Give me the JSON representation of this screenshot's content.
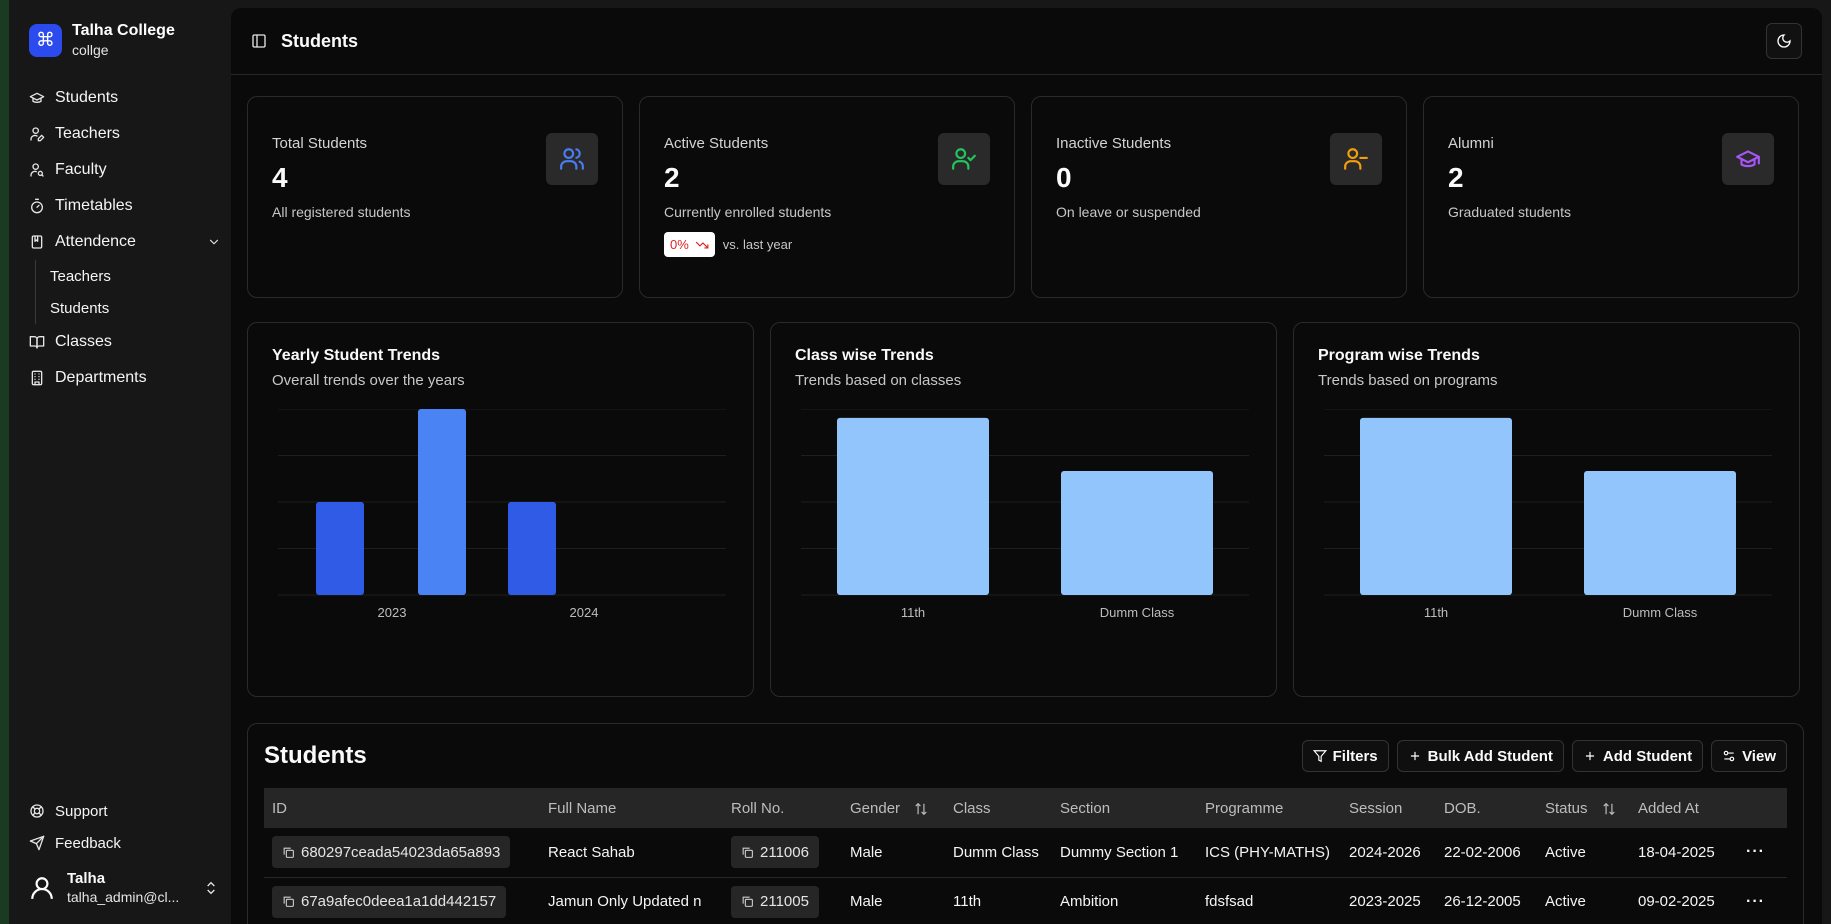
{
  "brand": {
    "name": "Talha College",
    "sub": "collge"
  },
  "nav": {
    "items": [
      {
        "label": "Students",
        "icon": "graduation-cap-icon"
      },
      {
        "label": "Teachers",
        "icon": "user-pen-icon"
      },
      {
        "label": "Faculty",
        "icon": "user-search-icon"
      },
      {
        "label": "Timetables",
        "icon": "timer-icon"
      },
      {
        "label": "Attendence",
        "icon": "notebook-icon"
      }
    ],
    "attendence_sub": [
      {
        "label": "Teachers"
      },
      {
        "label": "Students"
      }
    ],
    "items2": [
      {
        "label": "Classes",
        "icon": "book-open-icon"
      },
      {
        "label": "Departments",
        "icon": "building-icon"
      }
    ],
    "bottom": [
      {
        "label": "Support",
        "icon": "life-buoy-icon"
      },
      {
        "label": "Feedback",
        "icon": "send-icon"
      }
    ]
  },
  "user": {
    "name": "Talha",
    "email": "talha_admin@cl..."
  },
  "header": {
    "title": "Students"
  },
  "stats": [
    {
      "label": "Total Students",
      "value": "4",
      "desc": "All registered students",
      "icon": "users-icon",
      "color": "#4a7cf3"
    },
    {
      "label": "Active Students",
      "value": "2",
      "desc": "Currently enrolled students",
      "icon": "user-check-icon",
      "color": "#22c55e",
      "trend": {
        "badge": "0%",
        "text": "vs. last year"
      }
    },
    {
      "label": "Inactive Students",
      "value": "0",
      "desc": "On leave or suspended",
      "icon": "user-minus-icon",
      "color": "#f59e0b"
    },
    {
      "label": "Alumni",
      "value": "2",
      "desc": "Graduated students",
      "icon": "graduation-cap-icon",
      "color": "#a855f7"
    }
  ],
  "charts": [
    {
      "title": "Yearly Student Trends",
      "subtitle": "Overall trends over the years"
    },
    {
      "title": "Class wise Trends",
      "subtitle": "Trends based on classes"
    },
    {
      "title": "Program wise Trends",
      "subtitle": "Trends based on programs"
    }
  ],
  "chart_data": [
    {
      "type": "bar",
      "title": "Yearly Student Trends",
      "tick_labels": [
        "2023",
        "2024"
      ],
      "values": [
        1,
        2,
        1
      ],
      "ylim": [
        0,
        2
      ],
      "colors": [
        "#2f5be6",
        "#4a84f4",
        "#2f5be6"
      ],
      "grid": true
    },
    {
      "type": "bar",
      "title": "Class wise Trends",
      "categories": [
        "11th",
        "Dumm Class"
      ],
      "values": [
        2,
        1.4
      ],
      "ylim": [
        0,
        2.1
      ],
      "colors": [
        "#93c5fd",
        "#93c5fd"
      ],
      "grid": true
    },
    {
      "type": "bar",
      "title": "Program wise Trends",
      "categories": [
        "11th",
        "Dumm Class"
      ],
      "values": [
        2,
        1.4
      ],
      "ylim": [
        0,
        2.1
      ],
      "colors": [
        "#93c5fd",
        "#93c5fd"
      ],
      "grid": true
    }
  ],
  "table": {
    "title": "Students",
    "buttons": {
      "filters": "Filters",
      "bulk": "Bulk Add Student",
      "add": "Add Student",
      "view": "View"
    },
    "columns": [
      "ID",
      "Full Name",
      "Roll No.",
      "Gender",
      "Class",
      "Section",
      "Programme",
      "Session",
      "DOB.",
      "Status",
      "Added At"
    ],
    "rows": [
      [
        "680297ceada54023da65a893",
        "React Sahab",
        "211006",
        "Male",
        "Dumm Class",
        "Dummy Section 1",
        "ICS (PHY-MATHS)",
        "2024-2026",
        "22-02-2006",
        "Active",
        "18-04-2025"
      ],
      [
        "67a9afec0deea1a1dd442157",
        "Jamun Only Updated n",
        "211005",
        "Male",
        "11th",
        "Ambition",
        "fdsfsad",
        "2023-2025",
        "26-12-2005",
        "Active",
        "09-02-2025"
      ]
    ],
    "more": "···"
  }
}
